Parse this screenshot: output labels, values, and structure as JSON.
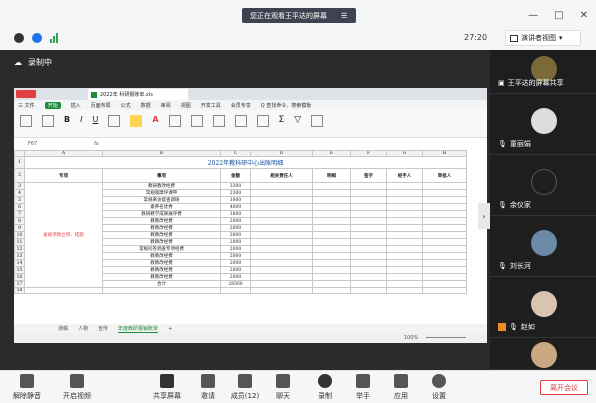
{
  "top": {
    "viewing": "您正在观看王平达的屏幕",
    "viewing_menu": "☰"
  },
  "status": {
    "timer": "27:20",
    "presenter_view": "演讲者视图",
    "recording": "录制中"
  },
  "wps": {
    "file_tab": "2022年 科研报账单.xls",
    "menu": [
      "三 文件",
      "开始",
      "插入",
      "页面布局",
      "公式",
      "数据",
      "审阅",
      "视图",
      "开发工具",
      "会员专享",
      "Q 查找命令、搜索模板"
    ],
    "cell_ref": "F67",
    "fx": "fx",
    "sheet_tabs": [
      "通稿",
      "人物",
      "宣传",
      "年度教研报销账单"
    ],
    "zoom": "100%"
  },
  "sheet": {
    "cols": [
      "A",
      "B",
      "C",
      "D",
      "E",
      "F",
      "G",
      "H"
    ],
    "title": "2022年教科研中心出账明细",
    "headers": [
      "专项",
      "事项",
      "金额",
      "相关责任人",
      "明细",
      "签字",
      "经手人",
      "审批人"
    ],
    "rows": [
      {
        "item": "教研教改经费",
        "amount": "3300"
      },
      {
        "item": "常规观摩评课申",
        "amount": "2300"
      },
      {
        "item": "常规来访督查调研",
        "amount": "1800"
      },
      {
        "item": "素养名优秀",
        "amount": "4000"
      },
      {
        "item": "教研教学成果展评费",
        "amount": "1800"
      },
      {
        "item": "教教改经费",
        "amount": "2000"
      },
      {
        "item": "教教改经费",
        "amount": "2000"
      },
      {
        "item": "教教改经费",
        "amount": "2000"
      },
      {
        "item": "教教改经费",
        "amount": "2000"
      },
      {
        "item": "常规问卷调查专项经费",
        "amount": "2000"
      },
      {
        "item": "教教改经费",
        "amount": "2000"
      },
      {
        "item": "教教改经费",
        "amount": "2000"
      },
      {
        "item": "教教改经费",
        "amount": "2000"
      },
      {
        "item": "教教改经费",
        "amount": "2000"
      },
      {
        "item": "合计",
        "amount": "28300"
      }
    ],
    "special": "省级项目立项、结题",
    "row_numbers": [
      "1",
      "2",
      "3",
      "4",
      "5",
      "6",
      "7",
      "8",
      "9",
      "10",
      "11",
      "12",
      "13",
      "14",
      "15",
      "16",
      "17",
      "18"
    ]
  },
  "participants": [
    {
      "name": "王平达的屏幕共享"
    },
    {
      "name": "童丽娟"
    },
    {
      "name": "余仪家"
    },
    {
      "name": "刘长河"
    },
    {
      "name": "赵如"
    }
  ],
  "bottom": {
    "mute": "解除静音",
    "video": "开启视频",
    "share": "共享屏幕",
    "invite": "邀请",
    "members": "成员(12)",
    "chat": "聊天",
    "record": "录制",
    "raise": "举手",
    "apps": "应用",
    "settings": "设置",
    "leave": "离开会议"
  },
  "colors": {
    "red": "#e04040",
    "green": "#2da44e",
    "blue": "#1a73e8",
    "excel_green": "#1b8a3a"
  }
}
